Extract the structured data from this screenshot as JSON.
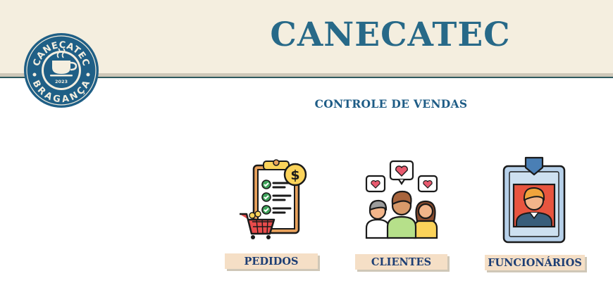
{
  "header": {
    "title": "CANECATEC",
    "subtitle": "CONTROLE DE VENDAS"
  },
  "logo": {
    "top_text": "CANECATEC",
    "bottom_text": "BRAGANÇA",
    "year": "2023",
    "icon": "coffee-cup-icon"
  },
  "menu": [
    {
      "label": "PEDIDOS",
      "icon": "clipboard-order-icon"
    },
    {
      "label": "CLIENTES",
      "icon": "customers-group-icon"
    },
    {
      "label": "FUNCIONÁRIOS",
      "icon": "employee-badge-icon"
    }
  ],
  "colors": {
    "header_bg": "#f4eedf",
    "title": "#276988",
    "button_bg": "#f5dfc6",
    "button_text": "#1d3e74",
    "logo_ring": "#1f5f86"
  }
}
